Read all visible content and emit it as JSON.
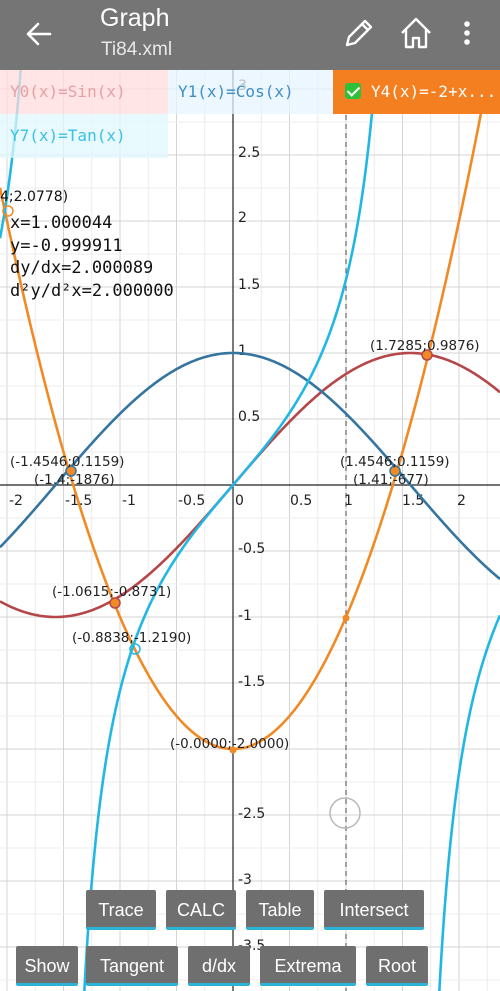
{
  "appbar": {
    "title": "Graph",
    "subtitle": "Ti84.xml"
  },
  "functions": {
    "y0": "Y0(x)=Sin(x)",
    "y1": "Y1(x)=Cos(x)",
    "y4": "Y4(x)=-2+x...",
    "y7": "Y7(x)=Tan(x)"
  },
  "trace": {
    "point": "4;2.0778)",
    "x": "x=1.000044",
    "y": "y=-0.999911",
    "dydx": "dy/dx=2.000089",
    "d2ydx2": "d²y/d²x=2.000000"
  },
  "points": {
    "p1": "(1.7285;0.9876)",
    "p2": "(-1.4546;0.1159)",
    "p3": "(-1.4;-1876)",
    "p4": "(1.4546;0.1159)",
    "p5": "(1.41;-677)",
    "p6": "(-1.0615;-0.8731)",
    "p7": "(-0.8838;-1.2190)",
    "p8": "(-0.0000;-2.0000)"
  },
  "axis": {
    "x_ticks": [
      "-2",
      "-1.5",
      "-1",
      "-0.5",
      "0",
      "0.5",
      "1",
      "1.5",
      "2"
    ],
    "y_ticks": [
      "3",
      "2.5",
      "2",
      "1.5",
      "1",
      "0.5",
      "-0.5",
      "-1",
      "-1.5",
      "-2.5",
      "-3",
      "-3.5"
    ]
  },
  "buttons": {
    "trace": "Trace",
    "calc": "CALC",
    "table": "Table",
    "intersect": "Intersect",
    "show": "Show",
    "tangent": "Tangent",
    "ddx": "d/dx",
    "extrema": "Extrema",
    "root": "Root"
  },
  "colors": {
    "sin": "#b5474b",
    "cos": "#35759f",
    "poly": "#f08a24",
    "tan": "#22b7e3",
    "appbar": "#757575"
  }
}
